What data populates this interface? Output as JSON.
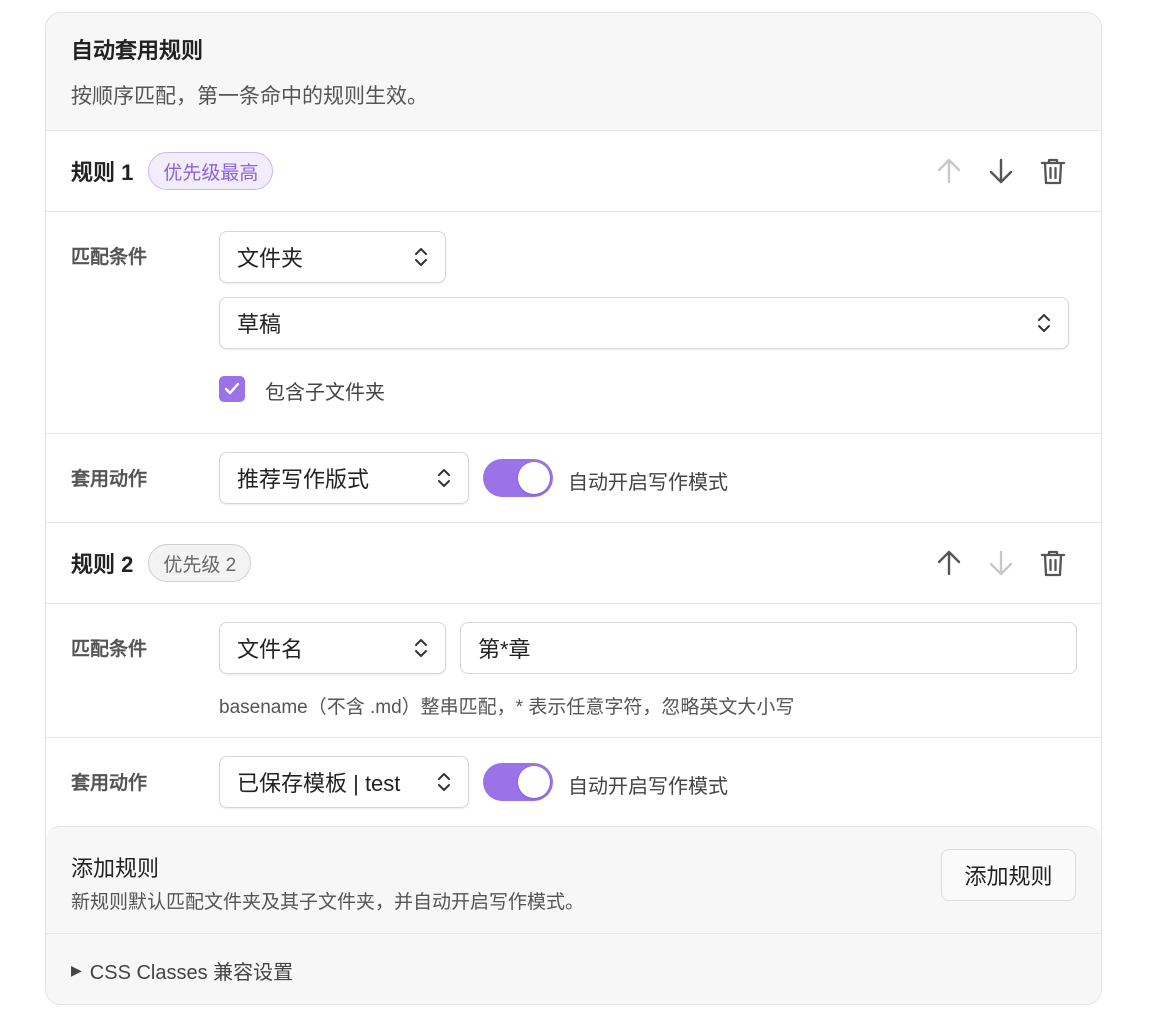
{
  "header": {
    "title": "自动套用规则",
    "description": "按顺序匹配，第一条命中的规则生效。"
  },
  "rules": [
    {
      "title": "规则 1",
      "badge": "优先级最高",
      "match_label": "匹配条件",
      "match_type": "文件夹",
      "folder_value": "草稿",
      "include_subfolders_label": "包含子文件夹",
      "include_subfolders": true,
      "action_label": "套用动作",
      "action_value": "推荐写作版式",
      "auto_mode_label": "自动开启写作模式",
      "auto_mode": true,
      "move_up_enabled": false,
      "move_down_enabled": true
    },
    {
      "title": "规则 2",
      "badge": "优先级 2",
      "match_label": "匹配条件",
      "match_type": "文件名",
      "pattern_value": "第*章",
      "hint": "basename（不含 .md）整串匹配，* 表示任意字符，忽略英文大小写",
      "action_label": "套用动作",
      "action_value": "已保存模板 | test",
      "auto_mode_label": "自动开启写作模式",
      "auto_mode": true,
      "move_up_enabled": true,
      "move_down_enabled": false
    }
  ],
  "add_rule": {
    "title": "添加规则",
    "description": "新规则默认匹配文件夹及其子文件夹，并自动开启写作模式。",
    "button_label": "添加规则"
  },
  "css_classes": {
    "label": "CSS Classes 兼容设置"
  },
  "colors": {
    "accent": "#9b72e8",
    "badge_top_text": "#8a63d8"
  },
  "icons": {
    "up": "arrow-up-icon",
    "down": "arrow-down-icon",
    "delete": "trash-icon",
    "select": "chevron-up-down-icon",
    "check": "check-icon",
    "expand": "triangle-right-icon"
  }
}
